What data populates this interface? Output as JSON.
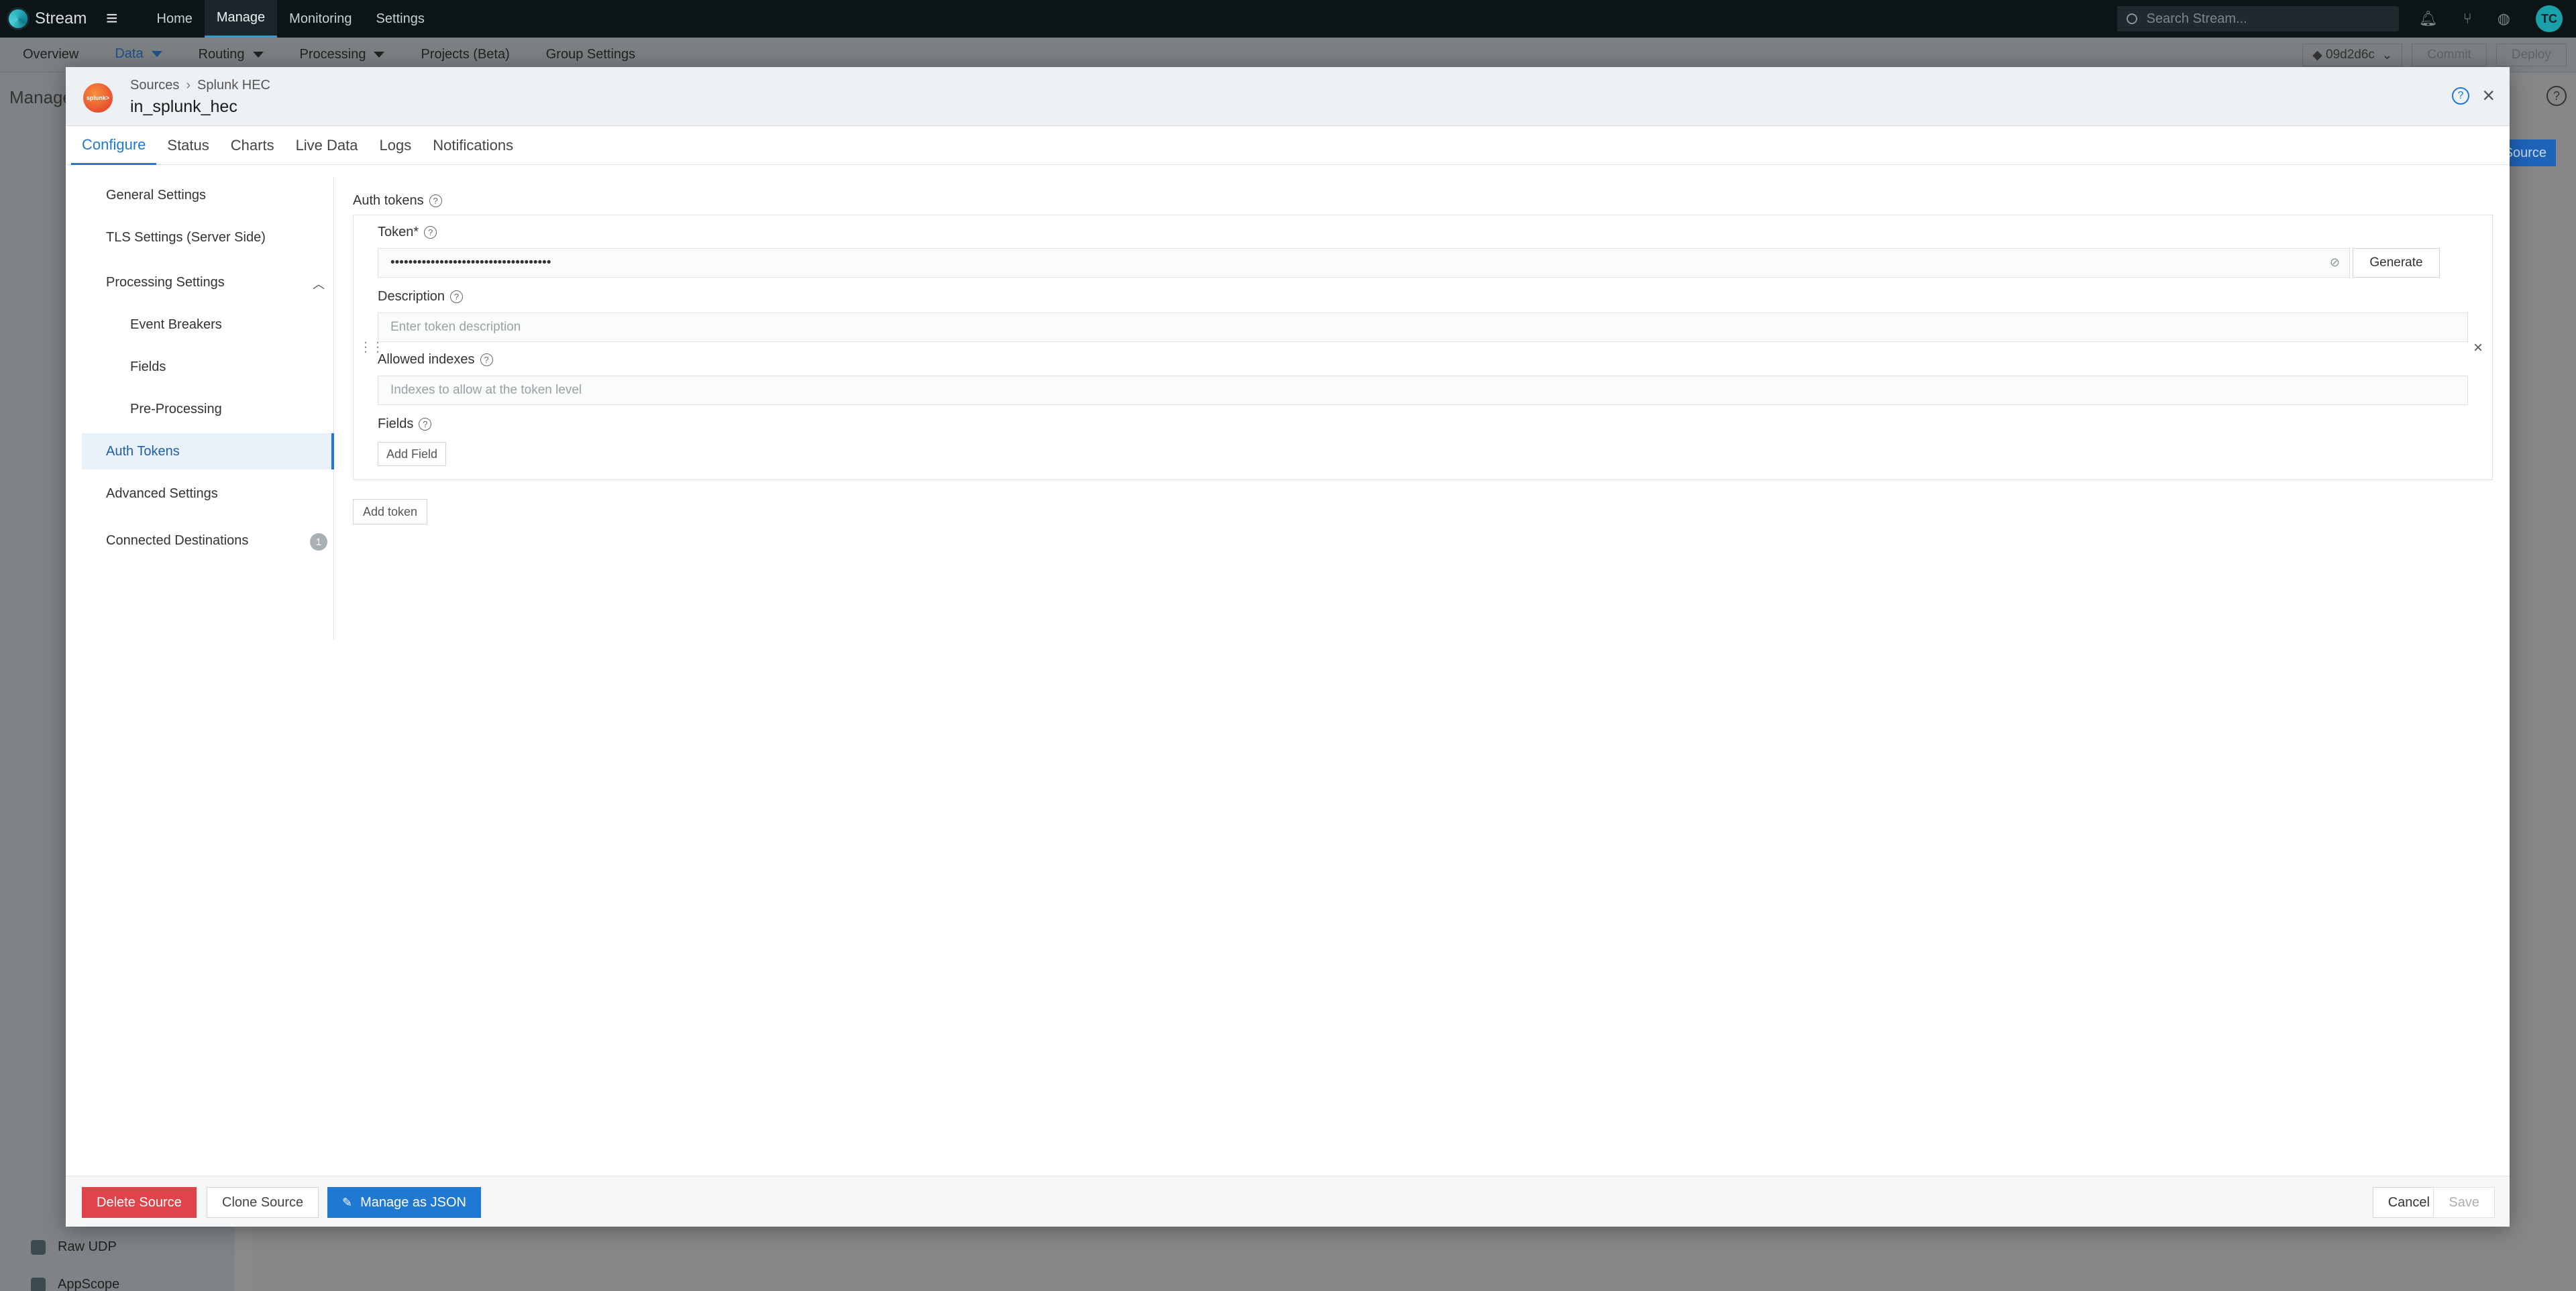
{
  "topbar": {
    "brand": "Stream",
    "nav": [
      "Home",
      "Manage",
      "Monitoring",
      "Settings"
    ],
    "search_placeholder": "Search Stream...",
    "avatar_initials": "TC"
  },
  "subnav": {
    "items": [
      "Overview",
      "Data",
      "Routing",
      "Processing",
      "Projects (Beta)",
      "Group Settings"
    ],
    "commit_hash": "09d2d6c",
    "commit_label": "Commit",
    "deploy_label": "Deploy"
  },
  "background": {
    "manage_label": "Manage",
    "source_button": "Source",
    "side_items": [
      "Raw UDP",
      "AppScope"
    ]
  },
  "modal": {
    "breadcrumb_root": "Sources",
    "breadcrumb_leaf": "Splunk HEC",
    "title": "in_splunk_hec",
    "logo_text": "splunk>",
    "tabs": [
      "Configure",
      "Status",
      "Charts",
      "Live Data",
      "Logs",
      "Notifications"
    ],
    "nav": {
      "general": "General Settings",
      "tls": "TLS Settings (Server Side)",
      "processing": "Processing Settings",
      "event_breakers": "Event Breakers",
      "fields": "Fields",
      "preprocessing": "Pre-Processing",
      "auth_tokens": "Auth Tokens",
      "advanced": "Advanced Settings",
      "connected": "Connected Destinations",
      "connected_count": "1"
    },
    "auth": {
      "section_label": "Auth tokens",
      "token_label": "Token*",
      "token_value": "••••••••••••••••••••••••••••••••••••",
      "generate": "Generate",
      "description_label": "Description",
      "description_placeholder": "Enter token description",
      "indexes_label": "Allowed indexes",
      "indexes_placeholder": "Indexes to allow at the token level",
      "fields_label": "Fields",
      "add_field": "Add Field",
      "add_token": "Add token"
    },
    "footer": {
      "delete": "Delete Source",
      "clone": "Clone Source",
      "json": "Manage as JSON",
      "cancel": "Cancel",
      "save": "Save"
    }
  }
}
